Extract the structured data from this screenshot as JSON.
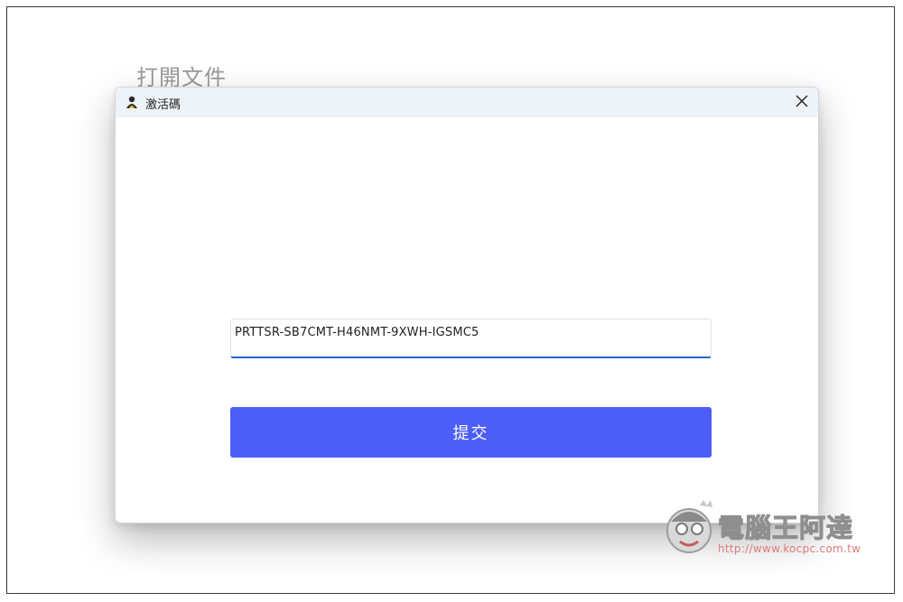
{
  "background": {
    "title": "打開文件"
  },
  "dialog": {
    "title": "激活碼",
    "app_icon": "person-avatar-icon",
    "close_icon": "close-icon",
    "input": {
      "value": "PRTTSR-SB7CMT-H46NMT-9XWH-IGSMC5"
    },
    "submit_label": "提交"
  },
  "watermark": {
    "brand": "電腦王阿達",
    "url": "http://www.kocpc.com.tw"
  },
  "colors": {
    "accent": "#4c5ef7",
    "input_underline": "#1f66c8",
    "titlebar_bg": "#eef3f8",
    "watermark_url": "#e07a7a"
  }
}
